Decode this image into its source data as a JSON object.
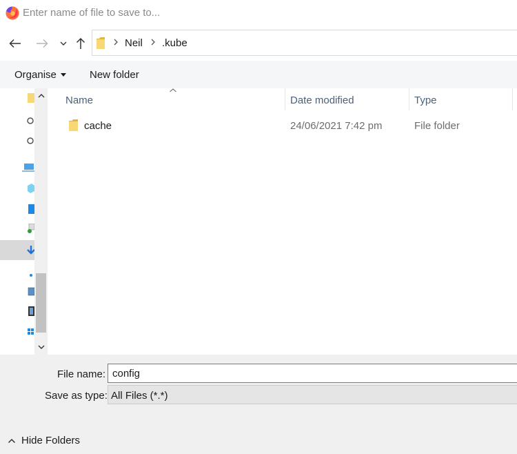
{
  "window": {
    "title_placeholder": "Enter name of file to save to..."
  },
  "navigation": {
    "breadcrumbs": [
      "Neil",
      ".kube"
    ]
  },
  "toolbar": {
    "organise_label": "Organise",
    "new_folder_label": "New folder"
  },
  "file_list": {
    "columns": [
      "Name",
      "Date modified",
      "Type"
    ],
    "rows": [
      {
        "name": "cache",
        "date_modified": "24/06/2021 7:42 pm",
        "type": "File folder"
      }
    ]
  },
  "form": {
    "file_name_label": "File name:",
    "file_name_value": "config",
    "save_as_type_label": "Save as type:",
    "save_as_type_value": "All Files (*.*)"
  },
  "footer": {
    "hide_folders_label": "Hide Folders"
  },
  "colors": {
    "folder": "#f8d775",
    "folder_dark": "#e3b441",
    "header_text": "#4c607a",
    "selection": "#d9d9d9"
  },
  "icons": [
    "firefox-icon",
    "back-arrow-icon",
    "forward-arrow-icon",
    "chevron-down-icon",
    "up-arrow-icon",
    "folder-icon",
    "chevron-right-icon",
    "chevron-up-icon",
    "sort-up-icon"
  ]
}
